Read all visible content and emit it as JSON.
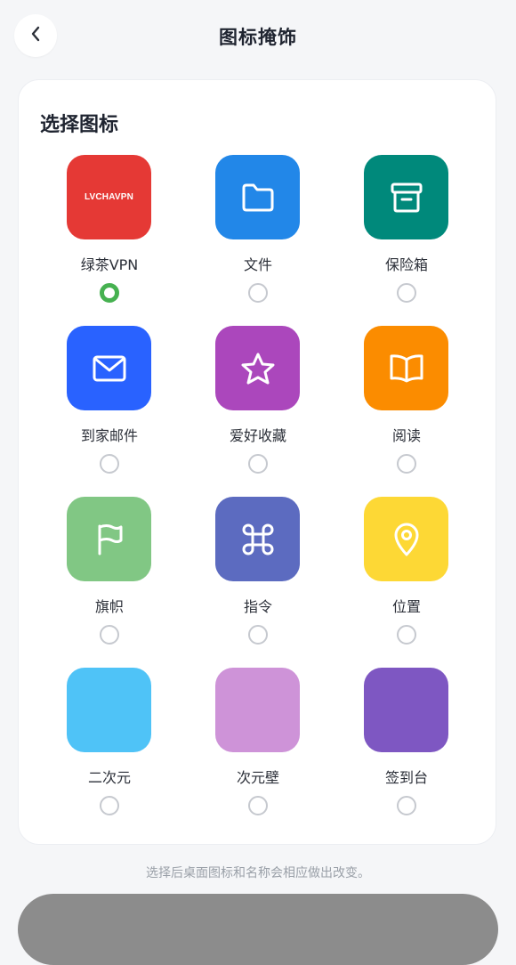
{
  "header": {
    "title": "图标掩饰",
    "back_icon": "chevron-left-icon"
  },
  "card": {
    "title": "选择图标",
    "icons": [
      {
        "label": "绿茶VPN",
        "color": "#e53935",
        "icon": "lvchavpn-logo",
        "tile_text": "LVCHAVPN",
        "selected": true
      },
      {
        "label": "文件",
        "color": "#2287e8",
        "icon": "folder-icon",
        "selected": false
      },
      {
        "label": "保险箱",
        "color": "#00897b",
        "icon": "archive-box-icon",
        "selected": false
      },
      {
        "label": "到家邮件",
        "color": "#2962ff",
        "icon": "mail-icon",
        "selected": false
      },
      {
        "label": "爱好收藏",
        "color": "#ab47bc",
        "icon": "star-icon",
        "selected": false
      },
      {
        "label": "阅读",
        "color": "#fb8c00",
        "icon": "book-icon",
        "selected": false
      },
      {
        "label": "旗帜",
        "color": "#81c784",
        "icon": "flag-icon",
        "selected": false
      },
      {
        "label": "指令",
        "color": "#5c6bc0",
        "icon": "command-icon",
        "selected": false
      },
      {
        "label": "位置",
        "color": "#fdd835",
        "icon": "location-pin-icon",
        "selected": false
      },
      {
        "label": "二次元",
        "color": "#4fc3f7",
        "icon": "",
        "selected": false
      },
      {
        "label": "次元壁",
        "color": "#ce93d8",
        "icon": "",
        "selected": false
      },
      {
        "label": "签到台",
        "color": "#7e57c2",
        "icon": "",
        "selected": false
      }
    ]
  },
  "hint": "选择后桌面图标和名称会相应做出改变。",
  "colors": {
    "radio_selected": "#46b150",
    "bottom_button": "#8c8c8c"
  }
}
